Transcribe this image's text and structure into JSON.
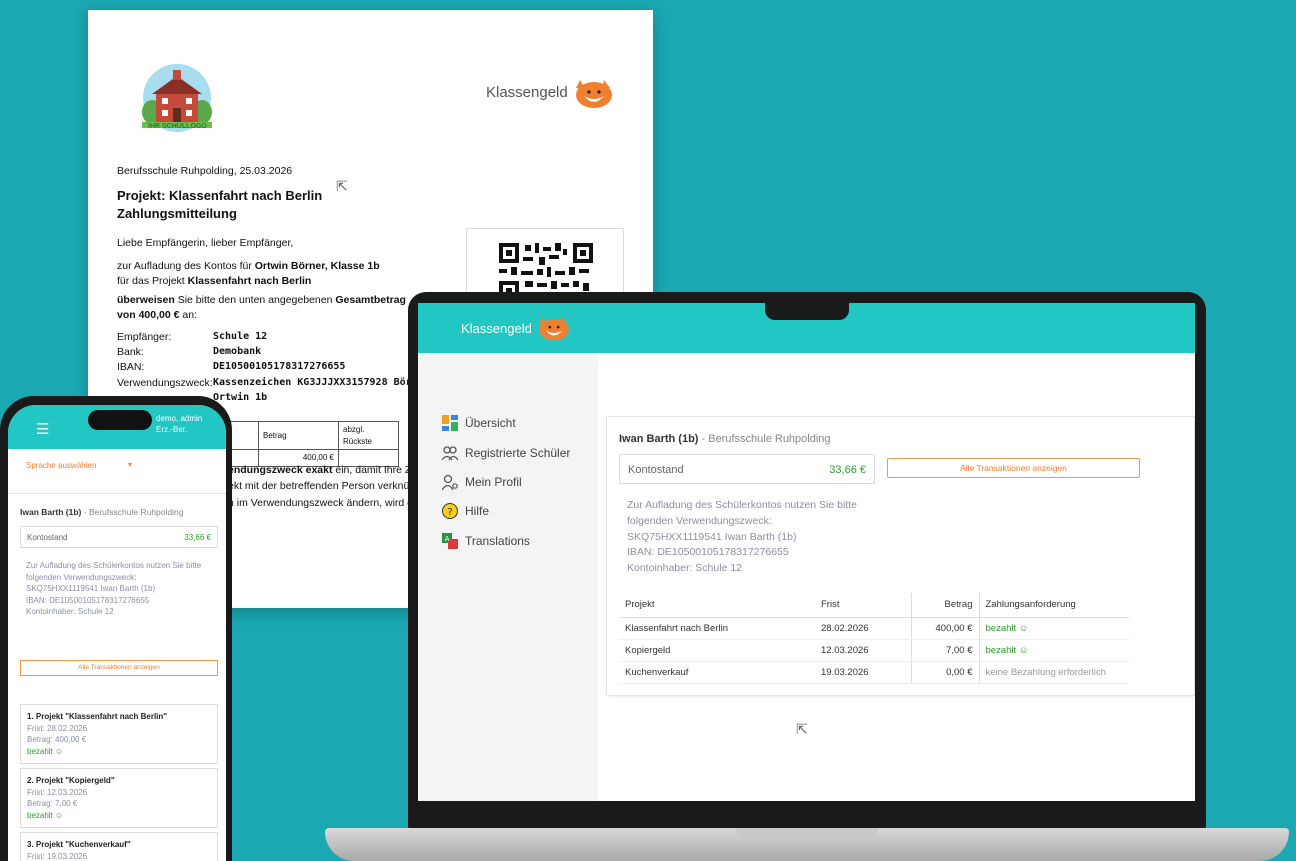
{
  "document": {
    "school_logo_text": "IHR SCHULLOGO",
    "brand": "Klassengeld",
    "place_date": "Berufsschule Ruhpolding, 25.03.2026",
    "title_line1": "Projekt: Klassenfahrt nach Berlin",
    "title_line2": "Zahlungsmitteilung",
    "greeting": "Liebe Empfängerin, lieber Empfänger,",
    "line_a_pre": "zur Aufladung des Kontos für ",
    "line_a_bold": "Ortwin Börner, Klasse 1b",
    "line_b_pre": "für das Projekt ",
    "line_b_bold": "Klassenfahrt nach Berlin",
    "transfer_bold1": "überweisen",
    "transfer_mid": " Sie bitte den unten angegebenen ",
    "transfer_bold2": "Gesamtbetrag",
    "transfer_bold3": "von 400,00 €",
    "transfer_end": "  an:",
    "fields": [
      {
        "k": "Empfänger:",
        "v": "Schule 12"
      },
      {
        "k": "Bank:",
        "v": "Demobank"
      },
      {
        "k": "IBAN:",
        "v": "DE10500105178317276655"
      },
      {
        "k": "Verwendungszweck:",
        "v": "Kassenzeichen KG3JJJXX3157928 Börner"
      },
      {
        "k": "",
        "v": "Ortwin 1b"
      }
    ],
    "table_h1": "Betrag",
    "table_h2": "abzgl. Rückste",
    "table_v1": "400,00 €",
    "note_bold": "endungszweck exakt",
    "note_rest": " ein, damit Ihre Z",
    "note_l2": "ekt mit der betreffenden Person verknüp",
    "note_l3": "n im Verwendungszweck ändern, wird di"
  },
  "laptop": {
    "brand": "Klassengeld",
    "nav": [
      {
        "label": "Übersicht",
        "icon": "dashboard-icon"
      },
      {
        "label": "Registrierte Schüler",
        "icon": "students-icon"
      },
      {
        "label": "Mein Profil",
        "icon": "profile-icon"
      },
      {
        "label": "Hilfe",
        "icon": "help-icon"
      },
      {
        "label": "Translations",
        "icon": "translations-icon"
      }
    ],
    "student": "Iwan Barth (1b)",
    "school": " - Berufsschule Ruhpolding",
    "balance_label": "Kontostand",
    "balance_value": "33,66 €",
    "all_tx_button": "Alle Transaktionen anzeigen",
    "info": [
      "Zur Aufladung des Schülerkontos nutzen Sie bitte",
      "folgenden Verwendungszweck:",
      "SKQ75HXX1119541 Iwan Barth (1b)",
      "IBAN: DE10500105178317276655",
      "Kontoinhaber: Schule 12"
    ],
    "columns": [
      "Projekt",
      "Frist",
      "Betrag",
      "Zahlungsanforderung"
    ],
    "rows": [
      {
        "project": "Klassenfahrt nach Berlin",
        "due": "28.02.2026",
        "amount": "400,00 €",
        "status": "bezahlt ☺"
      },
      {
        "project": "Kopiergeld",
        "due": "12.03.2026",
        "amount": "7,00 €",
        "status": "bezahlt ☺"
      },
      {
        "project": "Kuchenverkauf",
        "due": "19.03.2026",
        "amount": "0,00 €",
        "status": "keine Bezahlung erforderlich"
      }
    ]
  },
  "phone": {
    "user_name": "demo, admin",
    "user_role": "Erz.-Ber.",
    "language_select": "Sprache auswählen",
    "student": "Iwan Barth (1b)",
    "school": " - Berufsschule Ruhpolding",
    "balance_label": "Kontostand",
    "balance_value": "33,66 €",
    "info": [
      "Zur Aufladung des Schülerkontos nutzen Sie bitte",
      "folgenden Verwendungszweck:",
      "SKQ75HXX1119541 Iwan Barth (1b)",
      "IBAN: DE10500105178317276655",
      "Kontoinhaber: Schule 12"
    ],
    "all_tx_button": "Alle Transaktionen anzeigen",
    "projects": [
      {
        "title": "1. Projekt \"Klassenfahrt nach Berlin\"",
        "due": "Frist: 28.02.2026",
        "amount": "Betrag: 400,00 €",
        "status": "bezahlt ☺"
      },
      {
        "title": "2. Projekt \"Kopiergeld\"",
        "due": "Frist: 12.03.2026",
        "amount": "Betrag: 7,00 €",
        "status": "bezahlt ☺"
      },
      {
        "title": "3. Projekt \"Kuchenverkauf\"",
        "due": "Frist: 19.03.2026"
      }
    ]
  },
  "colors": {
    "background": "#1ba8b3",
    "app_bar": "#22c7c4",
    "accent_orange": "#f08030",
    "paid_green": "#2d9d2d"
  }
}
